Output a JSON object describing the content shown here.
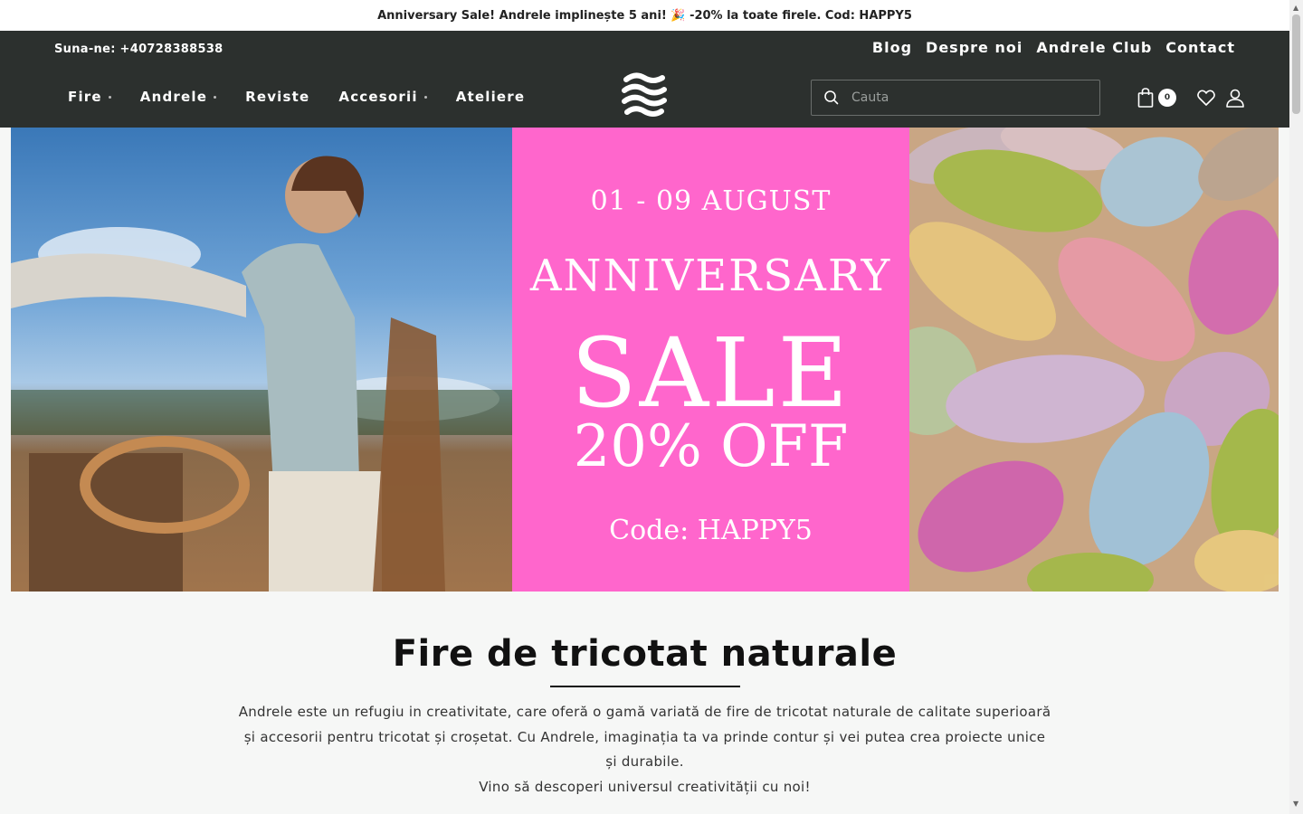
{
  "announcement": "Anniversary Sale! Andrele implinește 5 ani! 🎉 -20% la toate firele. Cod: HAPPY5",
  "header": {
    "phone": "Suna-ne: +40728388538",
    "top_links": [
      "Blog",
      "Despre noi",
      "Andrele Club",
      "Contact"
    ],
    "nav": [
      {
        "label": "Fire",
        "dropdown": true
      },
      {
        "label": "Andrele",
        "dropdown": true
      },
      {
        "label": "Reviste",
        "dropdown": false
      },
      {
        "label": "Accesorii",
        "dropdown": true
      },
      {
        "label": "Ateliere",
        "dropdown": false
      }
    ],
    "search_placeholder": "Cauta",
    "cart_count": "0"
  },
  "hero": {
    "date": "01 - 09 AUGUST",
    "line1": "ANNIVERSARY",
    "line2": "SALE",
    "line3": "20% OFF",
    "code": "Code: HAPPY5",
    "accent_color": "#ff66cc"
  },
  "intro": {
    "title": "Fire de tricotat naturale",
    "paragraph1": "Andrele este un refugiu in creativitate, care oferă o gamă variată de fire de tricotat naturale de calitate superioară și accesorii pentru tricotat și croșetat. Cu Andrele, imaginația ta va prinde contur și vei putea crea proiecte unice și durabile.",
    "paragraph2": "Vino să descoperi universul creativității cu noi!"
  },
  "colors": {
    "header_bg": "#2c302e",
    "page_bg": "#f6f7f6"
  }
}
